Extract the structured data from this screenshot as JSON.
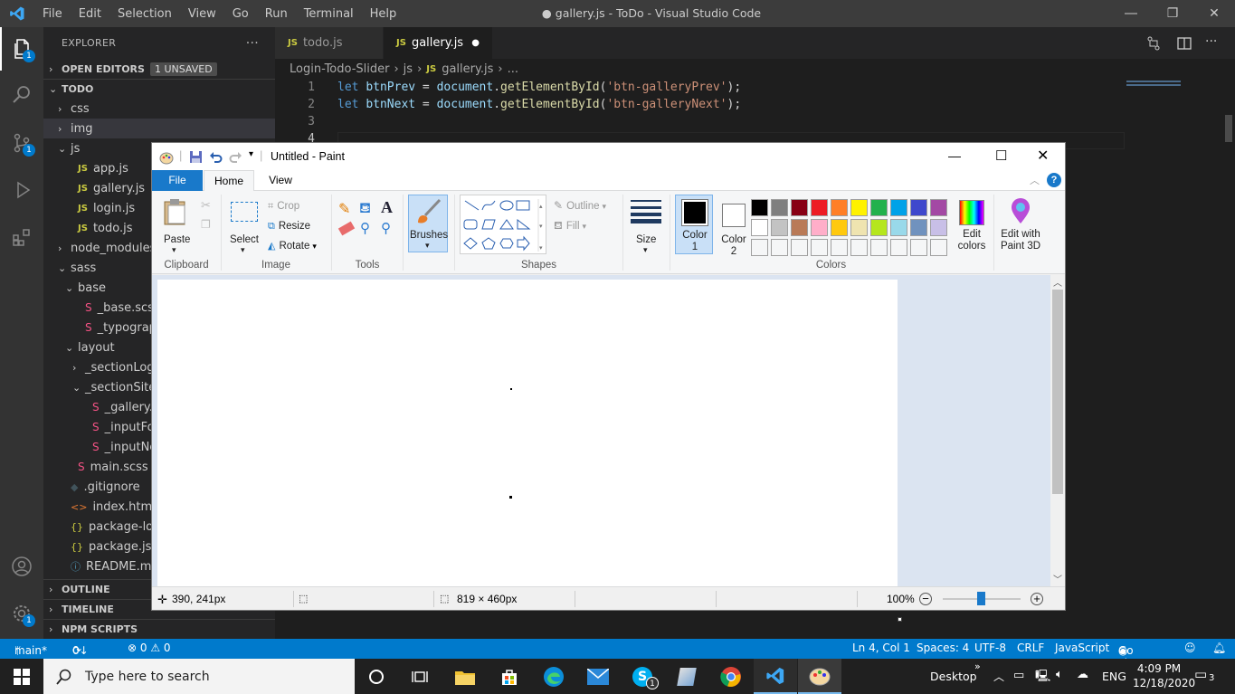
{
  "vscode": {
    "menu": [
      "File",
      "Edit",
      "Selection",
      "View",
      "Go",
      "Run",
      "Terminal",
      "Help"
    ],
    "window_title": "● gallery.js - ToDo - Visual Studio Code",
    "explorer_label": "EXPLORER",
    "open_editors": "OPEN EDITORS",
    "unsaved_badge": "1 UNSAVED",
    "root_folder": "TODO",
    "tree": [
      {
        "label": "css",
        "indent": 1,
        "chev": "›",
        "icon": ""
      },
      {
        "label": "img",
        "indent": 1,
        "chev": "›",
        "icon": ""
      },
      {
        "label": "js",
        "indent": 1,
        "chev": "⌄",
        "icon": ""
      },
      {
        "label": "app.js",
        "indent": 2,
        "chev": "",
        "icon": "JS"
      },
      {
        "label": "gallery.js",
        "indent": 2,
        "chev": "",
        "icon": "JS"
      },
      {
        "label": "login.js",
        "indent": 2,
        "chev": "",
        "icon": "JS"
      },
      {
        "label": "todo.js",
        "indent": 2,
        "chev": "",
        "icon": "JS"
      },
      {
        "label": "node_modules",
        "indent": 1,
        "chev": "›",
        "icon": ""
      },
      {
        "label": "sass",
        "indent": 1,
        "chev": "⌄",
        "icon": ""
      },
      {
        "label": "base",
        "indent": 2,
        "chev": "⌄",
        "icon": ""
      },
      {
        "label": "_base.scss",
        "indent": 3,
        "chev": "",
        "icon": "S"
      },
      {
        "label": "_typography.scss",
        "indent": 3,
        "chev": "",
        "icon": "S"
      },
      {
        "label": "layout",
        "indent": 2,
        "chev": "⌄",
        "icon": ""
      },
      {
        "label": "_sectionLogin",
        "indent": 3,
        "chev": "›",
        "icon": ""
      },
      {
        "label": "_sectionSite",
        "indent": 3,
        "chev": "⌄",
        "icon": ""
      },
      {
        "label": "_gallery.scss",
        "indent": 4,
        "chev": "",
        "icon": "S"
      },
      {
        "label": "_inputForm.scss",
        "indent": 4,
        "chev": "",
        "icon": "S"
      },
      {
        "label": "_inputNew.scss",
        "indent": 4,
        "chev": "",
        "icon": "S"
      },
      {
        "label": "main.scss",
        "indent": 2,
        "chev": "",
        "icon": "S"
      },
      {
        "label": ".gitignore",
        "indent": 1,
        "chev": "",
        "icon": "◆"
      },
      {
        "label": "index.html",
        "indent": 1,
        "chev": "",
        "icon": "<>"
      },
      {
        "label": "package-lock.json",
        "indent": 1,
        "chev": "",
        "icon": "{}"
      },
      {
        "label": "package.json",
        "indent": 1,
        "chev": "",
        "icon": "{}"
      },
      {
        "label": "README.md",
        "indent": 1,
        "chev": "",
        "icon": "ⓘ"
      }
    ],
    "outline": "OUTLINE",
    "timeline": "TIMELINE",
    "npm_scripts": "NPM SCRIPTS",
    "tabs": [
      "todo.js",
      "gallery.js"
    ],
    "breadcrumb": [
      "Login-Todo-Slider",
      "js",
      "gallery.js",
      "..."
    ],
    "code_lines": [
      {
        "n": "1",
        "kw": "let",
        "var": "btnPrev",
        "eq": " = ",
        "obj": "document",
        "fn": "getElementById",
        "str": "'btn-galleryPrev'",
        "end": ");"
      },
      {
        "n": "2",
        "kw": "let",
        "var": "btnNext",
        "eq": " = ",
        "obj": "document",
        "fn": "getElementById",
        "str": "'btn-galleryNext'",
        "end": ");"
      },
      {
        "n": "3"
      },
      {
        "n": "4"
      }
    ],
    "status": {
      "branch": "main*",
      "sync": "0↓ 4↑",
      "problems": "⊗ 0 ⚠ 0",
      "position": "Ln 4, Col 1",
      "spaces": "Spaces: 4",
      "encoding": "UTF-8",
      "eol": "CRLF",
      "language": "JavaScript",
      "golive": "Go Live"
    },
    "badges": {
      "explorer": "1",
      "scm": "1",
      "settings": "1"
    }
  },
  "paint": {
    "title": "Untitled - Paint",
    "tabs": [
      "File",
      "Home",
      "View"
    ],
    "groups": [
      "Clipboard",
      "Image",
      "Tools",
      "Shapes",
      "Colors"
    ],
    "buttons": {
      "paste": "Paste",
      "select": "Select",
      "crop": "Crop",
      "resize": "Resize",
      "rotate": "Rotate",
      "brushes": "Brushes",
      "outline": "Outline",
      "fill": "Fill",
      "size": "Size",
      "color1": "Color 1",
      "color2": "Color 2",
      "edit_colors": "Edit colors",
      "edit_paint3d": "Edit with Paint 3D"
    },
    "palette_row1": [
      "#000000",
      "#7f7f7f",
      "#880015",
      "#ed1c24",
      "#ff7f27",
      "#fff200",
      "#22b14c",
      "#00a2e8",
      "#3f48cc",
      "#a349a4"
    ],
    "palette_row2": [
      "#ffffff",
      "#c3c3c3",
      "#b97a57",
      "#ffaec9",
      "#ffc90e",
      "#efe4b0",
      "#b5e61d",
      "#99d9ea",
      "#7092be",
      "#c8bfe7"
    ],
    "color1": "#000000",
    "color2": "#ffffff",
    "status": {
      "cursor": "390, 241px",
      "canvas_size": "819 × 460px",
      "zoom": "100%"
    }
  },
  "taskbar": {
    "search_placeholder": "Type here to search",
    "desktop": "Desktop",
    "language": "ENG",
    "time": "4:09 PM",
    "date": "12/18/2020",
    "notifications": "3"
  }
}
